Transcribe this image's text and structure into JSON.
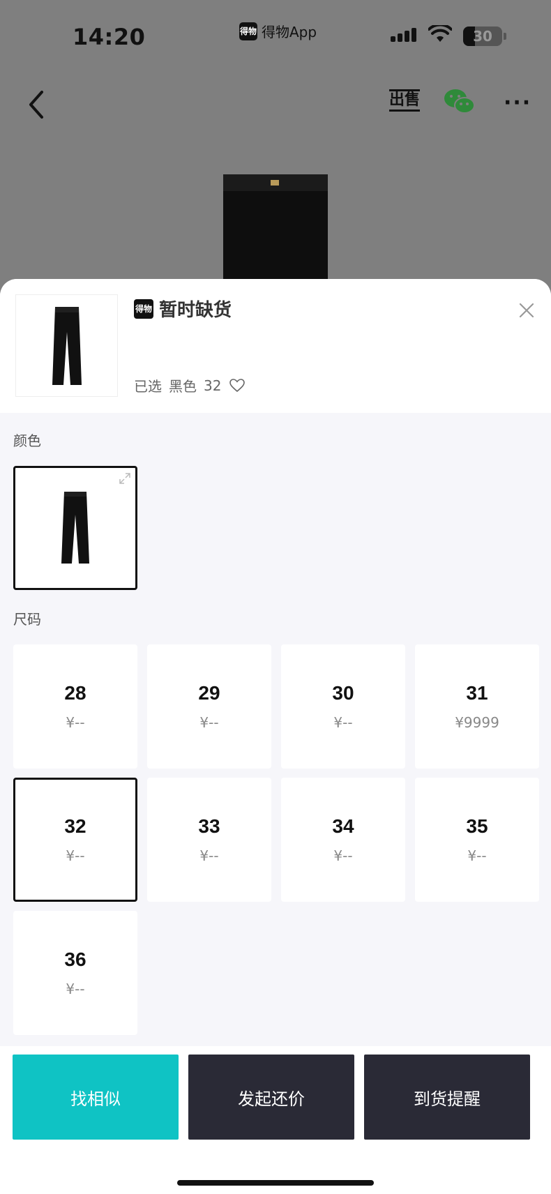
{
  "status_bar": {
    "time": "14:20",
    "app_name": "得物App",
    "app_logo": "得物",
    "battery_level": "30",
    "battery_fraction": 0.3
  },
  "nav": {
    "back_icon": "chevron-left-icon",
    "sell_label": "出售",
    "wechat_icon": "wechat-icon",
    "more_icon": "more-horizontal-icon"
  },
  "sheet": {
    "logo": "得物",
    "status": "暂时缺货",
    "selected_prefix": "已选",
    "selected_color": "黑色",
    "selected_size": "32",
    "color_label": "颜色",
    "size_label": "尺码",
    "sizes": [
      {
        "size": "28",
        "price": "¥--"
      },
      {
        "size": "29",
        "price": "¥--"
      },
      {
        "size": "30",
        "price": "¥--"
      },
      {
        "size": "31",
        "price": "¥9999"
      },
      {
        "size": "32",
        "price": "¥--"
      },
      {
        "size": "33",
        "price": "¥--"
      },
      {
        "size": "34",
        "price": "¥--"
      },
      {
        "size": "35",
        "price": "¥--"
      },
      {
        "size": "36",
        "price": "¥--"
      }
    ]
  },
  "actions": {
    "similar": "找相似",
    "bargain": "发起还价",
    "notify": "到货提醒"
  },
  "colors": {
    "accent": "#0fc3c4",
    "dark_button": "#2a2a36"
  }
}
